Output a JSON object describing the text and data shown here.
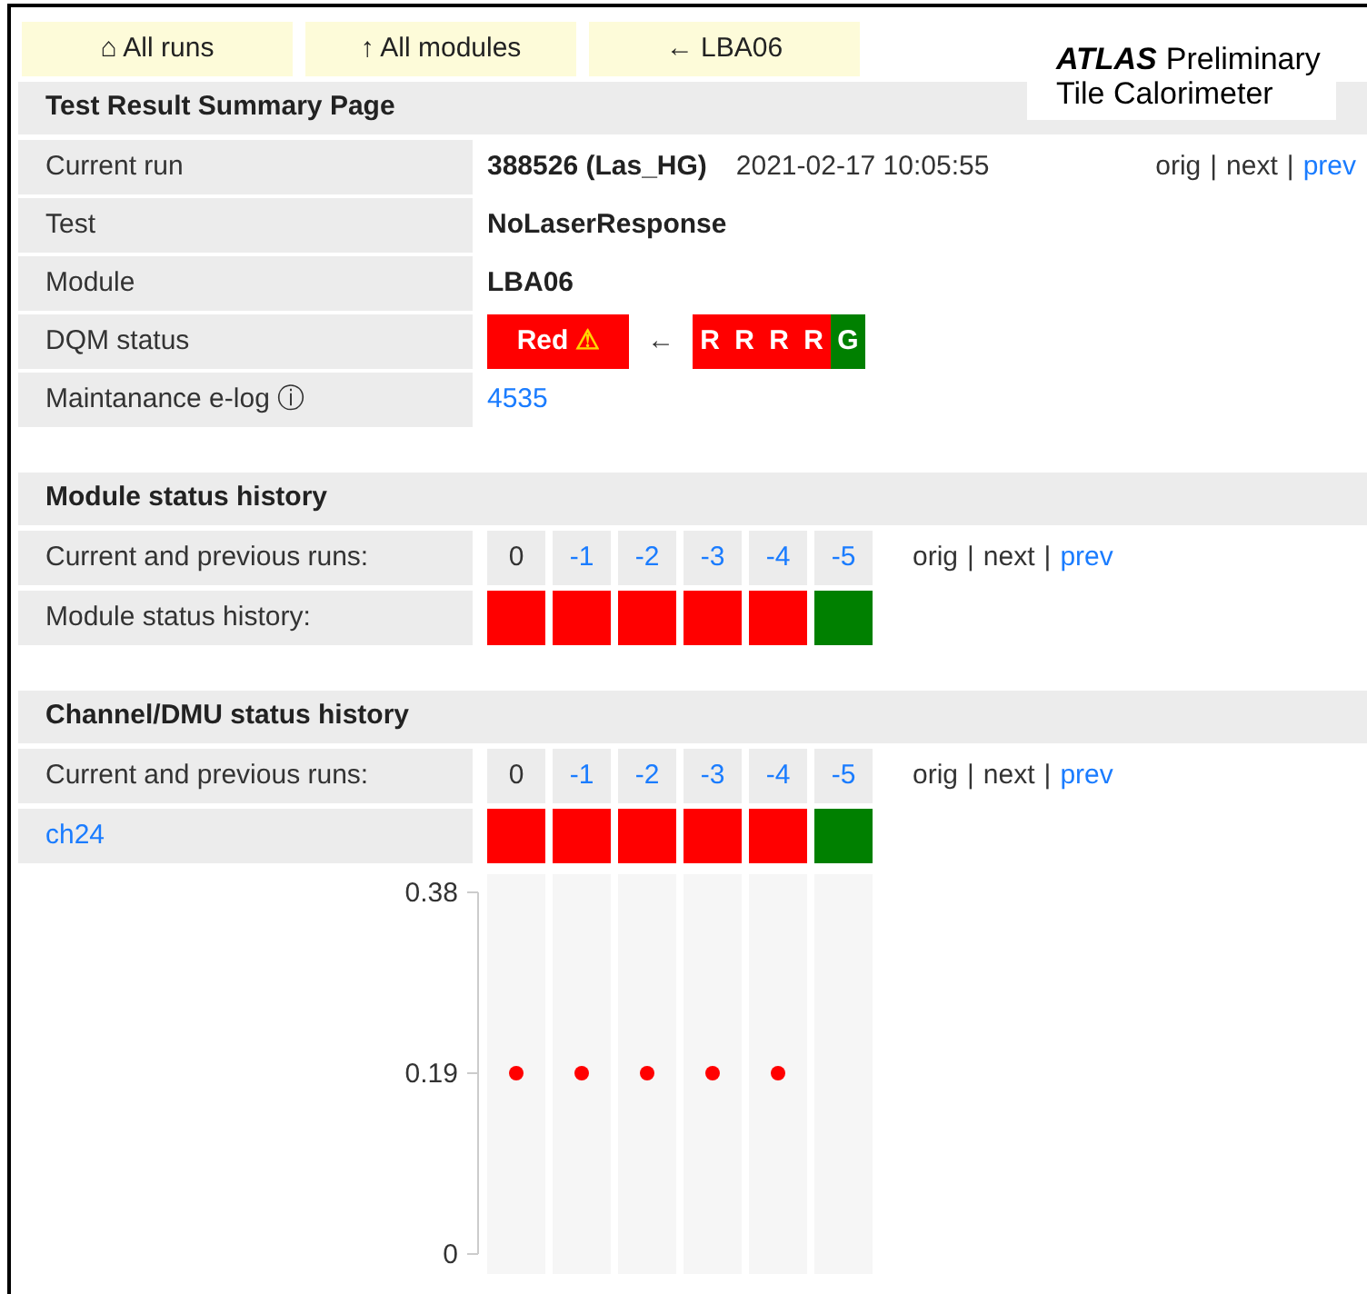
{
  "nav": [
    {
      "label": "⌂ All runs"
    },
    {
      "label": "↑ All modules"
    },
    {
      "label": "← LBA06"
    }
  ],
  "logo": {
    "brand": "ATLAS",
    "line1": "Preliminary",
    "line2": "Tile Calorimeter"
  },
  "summary": {
    "title": "Test Result Summary Page",
    "rows": [
      {
        "kind": "run",
        "label": "Current run",
        "value": "388526 (Las_HG)",
        "date": "2021-02-17 10:05:55",
        "nav": [
          {
            "label": "orig",
            "link": false
          },
          {
            "label": "next",
            "link": false
          },
          {
            "label": "prev",
            "link": true
          }
        ],
        "separator": "|"
      },
      {
        "kind": "bold",
        "label": "Test",
        "value": "NoLaserResponse"
      },
      {
        "kind": "bold",
        "label": "Module",
        "value": "LBA06"
      },
      {
        "kind": "dqm",
        "label": "DQM status",
        "status": {
          "label": "Red",
          "color": "#ff0000",
          "warning": true,
          "warning_icon": "⚠"
        },
        "arrow": "←",
        "history": [
          {
            "letter": "R",
            "color": "#ff0000"
          },
          {
            "letter": "R",
            "color": "#ff0000"
          },
          {
            "letter": "R",
            "color": "#ff0000"
          },
          {
            "letter": "R",
            "color": "#ff0000"
          },
          {
            "letter": "G",
            "color": "#008000"
          }
        ]
      },
      {
        "kind": "link",
        "label": "Maintanance e-log ⓘ",
        "value": "4535"
      }
    ]
  },
  "module_history": {
    "title": "Module status history",
    "runs_label": "Current and previous runs:",
    "runs": [
      {
        "label": "0",
        "link": false
      },
      {
        "label": "-1",
        "link": true
      },
      {
        "label": "-2",
        "link": true
      },
      {
        "label": "-3",
        "link": true
      },
      {
        "label": "-4",
        "link": true
      },
      {
        "label": "-5",
        "link": true
      }
    ],
    "nav": [
      {
        "label": "orig",
        "link": false
      },
      {
        "label": "next",
        "link": false
      },
      {
        "label": "prev",
        "link": true
      }
    ],
    "separator": "|",
    "status_label": "Module status history:",
    "statuses": [
      {
        "color": "#ff0000"
      },
      {
        "color": "#ff0000"
      },
      {
        "color": "#ff0000"
      },
      {
        "color": "#ff0000"
      },
      {
        "color": "#ff0000"
      },
      {
        "color": "#008000"
      }
    ]
  },
  "channel_history": {
    "title": "Channel/DMU status history",
    "runs_label": "Current and previous runs:",
    "run_links": [
      false,
      true,
      true,
      true,
      true,
      true
    ],
    "nav": [
      {
        "label": "orig",
        "link": false
      },
      {
        "label": "next",
        "link": false
      },
      {
        "label": "prev",
        "link": true
      }
    ],
    "separator": "|",
    "channel": "ch24",
    "statuses": [
      {
        "color": "#ff0000"
      },
      {
        "color": "#ff0000"
      },
      {
        "color": "#ff0000"
      },
      {
        "color": "#ff0000"
      },
      {
        "color": "#ff0000"
      },
      {
        "color": "#008000"
      }
    ],
    "chart_data": {
      "type": "scatter",
      "categories": [
        "0",
        "-1",
        "-2",
        "-3",
        "-4",
        "-5"
      ],
      "series": [
        {
          "color": "#ff0000",
          "values": [
            0.19,
            0.19,
            0.19,
            0.19,
            0.19,
            null
          ]
        }
      ],
      "ylim": [
        0,
        0.38
      ],
      "yticks": [
        {
          "value": 0,
          "label": "0"
        },
        {
          "value": 0.19,
          "label": "0.19"
        },
        {
          "value": 0.38,
          "label": "0.38"
        }
      ]
    }
  }
}
